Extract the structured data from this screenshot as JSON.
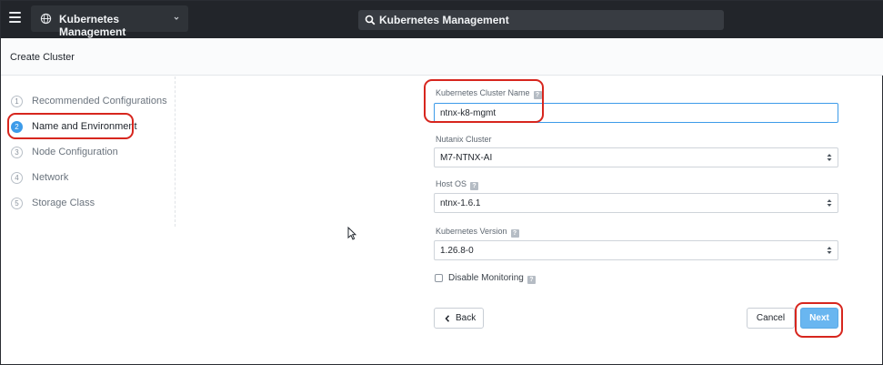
{
  "topbar": {
    "app_name": "Kubernetes Management",
    "search_text": "Kubernetes Management"
  },
  "page": {
    "title": "Create Cluster"
  },
  "steps": [
    {
      "num": "1",
      "label": "Recommended Configurations",
      "active": false
    },
    {
      "num": "2",
      "label": "Name and Environment",
      "active": true
    },
    {
      "num": "3",
      "label": "Node Configuration",
      "active": false
    },
    {
      "num": "4",
      "label": "Network",
      "active": false
    },
    {
      "num": "5",
      "label": "Storage Class",
      "active": false
    }
  ],
  "form": {
    "cluster_name": {
      "label": "Kubernetes Cluster Name",
      "help": "?",
      "value": "ntnx-k8-mgmt"
    },
    "nutanix_cluster": {
      "label": "Nutanix Cluster",
      "value": "M7-NTNX-AI"
    },
    "host_os": {
      "label": "Host OS",
      "help": "?",
      "value": "ntnx-1.6.1"
    },
    "k8s_version": {
      "label": "Kubernetes Version",
      "help": "?",
      "value": "1.26.8-0"
    },
    "disable_monitoring": {
      "label": "Disable Monitoring",
      "help": "?",
      "checked": false
    }
  },
  "buttons": {
    "back": "Back",
    "cancel": "Cancel",
    "next": "Next"
  },
  "colors": {
    "accent": "#3d9be9",
    "annotation": "#d7261e"
  },
  "icons": {
    "menu": "hamburger-icon",
    "app": "globe-icon",
    "search": "search-icon"
  }
}
